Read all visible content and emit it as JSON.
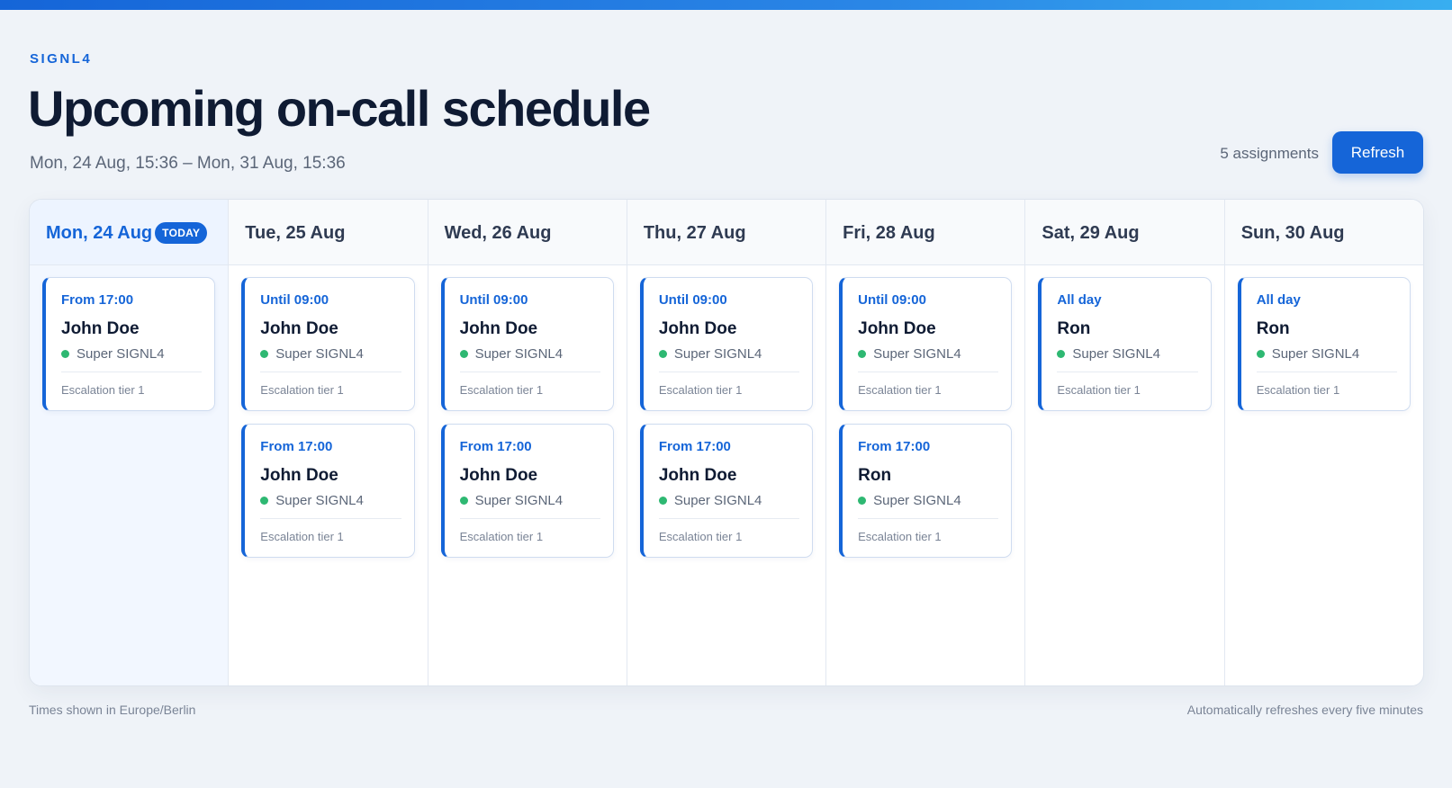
{
  "brand": "SIGNL4",
  "header": {
    "title": "Upcoming on-call schedule",
    "range": "Mon, 24 Aug, 15:36 – Mon, 31 Aug, 15:36",
    "assignment_count": "5 assignments",
    "refresh_label": "Refresh"
  },
  "colors": {
    "accent": "#1565d8",
    "status_on": "#2eb872",
    "background": "#eff3f8"
  },
  "days": [
    {
      "label": "Mon, 24 Aug",
      "today": true,
      "badge": "TODAY",
      "shifts": [
        {
          "time": "From 17:00",
          "name": "John Doe",
          "team": "Super SIGNL4",
          "tier": "Escalation tier 1"
        }
      ]
    },
    {
      "label": "Tue, 25 Aug",
      "today": false,
      "shifts": [
        {
          "time": "Until 09:00",
          "name": "John Doe",
          "team": "Super SIGNL4",
          "tier": "Escalation tier 1"
        },
        {
          "time": "From 17:00",
          "name": "John Doe",
          "team": "Super SIGNL4",
          "tier": "Escalation tier 1"
        }
      ]
    },
    {
      "label": "Wed, 26 Aug",
      "today": false,
      "shifts": [
        {
          "time": "Until 09:00",
          "name": "John Doe",
          "team": "Super SIGNL4",
          "tier": "Escalation tier 1"
        },
        {
          "time": "From 17:00",
          "name": "John Doe",
          "team": "Super SIGNL4",
          "tier": "Escalation tier 1"
        }
      ]
    },
    {
      "label": "Thu, 27 Aug",
      "today": false,
      "shifts": [
        {
          "time": "Until 09:00",
          "name": "John Doe",
          "team": "Super SIGNL4",
          "tier": "Escalation tier 1"
        },
        {
          "time": "From 17:00",
          "name": "John Doe",
          "team": "Super SIGNL4",
          "tier": "Escalation tier 1"
        }
      ]
    },
    {
      "label": "Fri, 28 Aug",
      "today": false,
      "shifts": [
        {
          "time": "Until 09:00",
          "name": "John Doe",
          "team": "Super SIGNL4",
          "tier": "Escalation tier 1"
        },
        {
          "time": "From 17:00",
          "name": "Ron",
          "team": "Super SIGNL4",
          "tier": "Escalation tier 1"
        }
      ]
    },
    {
      "label": "Sat, 29 Aug",
      "today": false,
      "shifts": [
        {
          "time": "All day",
          "name": "Ron",
          "team": "Super SIGNL4",
          "tier": "Escalation tier 1"
        }
      ]
    },
    {
      "label": "Sun, 30 Aug",
      "today": false,
      "shifts": [
        {
          "time": "All day",
          "name": "Ron",
          "team": "Super SIGNL4",
          "tier": "Escalation tier 1"
        }
      ]
    }
  ],
  "footer": {
    "timezone_note": "Times shown in Europe/Berlin",
    "refresh_note": "Automatically refreshes every five minutes"
  }
}
